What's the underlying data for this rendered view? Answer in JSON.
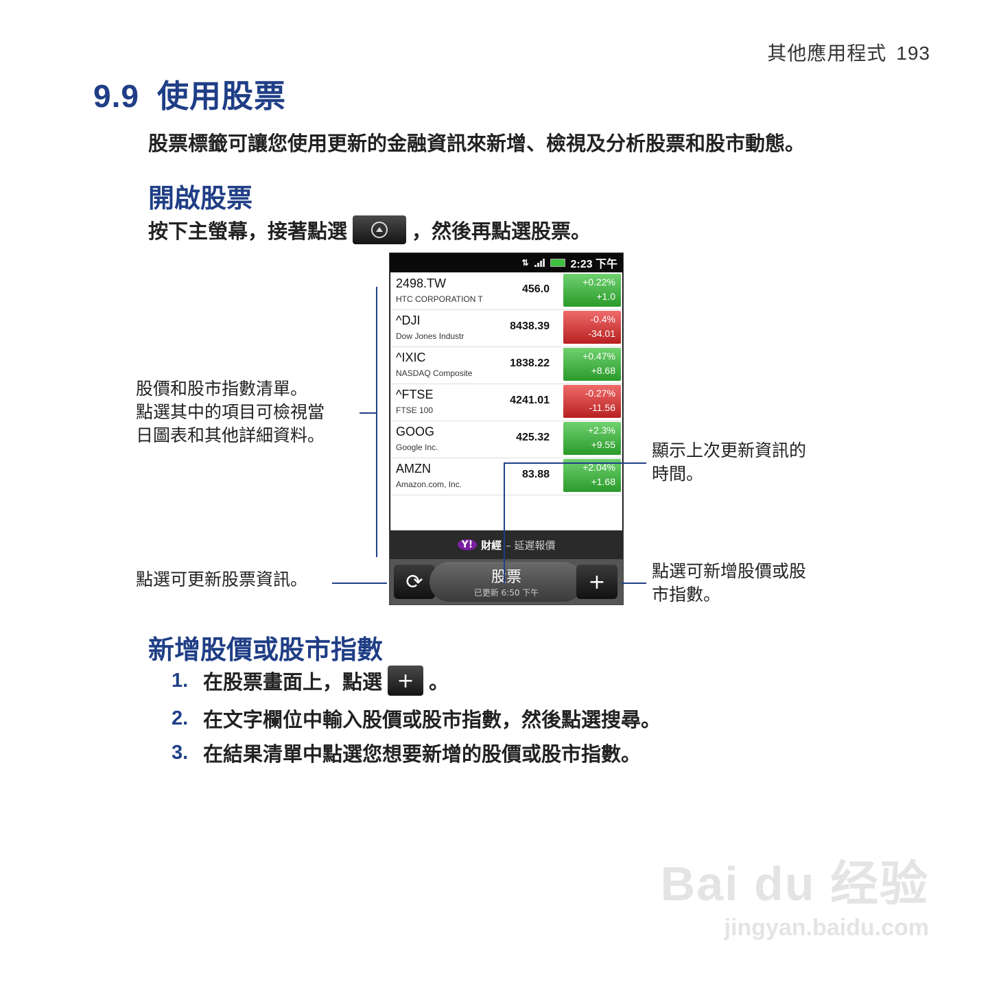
{
  "header": {
    "section": "其他應用程式",
    "page": "193"
  },
  "section": {
    "number": "9.9",
    "title": "使用股票"
  },
  "intro": "股票標籤可讓您使用更新的金融資訊來新增、檢視及分析股票和股市動態。",
  "open": {
    "heading": "開啟股票",
    "text_before": "按下主螢幕，接著點選",
    "text_after": "，然後再點選股票。"
  },
  "phone": {
    "status_time": "2:23 下午",
    "stocks": [
      {
        "symbol": "2498.TW",
        "name": "HTC CORPORATION T",
        "price": "456.0",
        "pct": "+0.22%",
        "chg": "+1.0",
        "dir": "up"
      },
      {
        "symbol": "^DJI",
        "name": "Dow Jones Industr",
        "price": "8438.39",
        "pct": "-0.4%",
        "chg": "-34.01",
        "dir": "down"
      },
      {
        "symbol": "^IXIC",
        "name": "NASDAQ Composite",
        "price": "1838.22",
        "pct": "+0.47%",
        "chg": "+8.68",
        "dir": "up"
      },
      {
        "symbol": "^FTSE",
        "name": "FTSE 100",
        "price": "4241.01",
        "pct": "-0.27%",
        "chg": "-11.56",
        "dir": "down"
      },
      {
        "symbol": "GOOG",
        "name": "Google Inc.",
        "price": "425.32",
        "pct": "+2.3%",
        "chg": "+9.55",
        "dir": "up"
      },
      {
        "symbol": "AMZN",
        "name": "Amazon.com, Inc.",
        "price": "83.88",
        "pct": "+2.04%",
        "chg": "+1.68",
        "dir": "up"
      }
    ],
    "footer_logo": "Y!",
    "footer_brand": "財經",
    "footer_text": "– 延遲報價",
    "bottom_title": "股票",
    "bottom_sub": "已更新 6:50 下午"
  },
  "callouts": {
    "list": [
      "股價和股市指數清單。",
      "點選其中的項目可檢視當",
      "日圖表和其他詳細資料。"
    ],
    "refresh": "點選可更新股票資訊。",
    "time": [
      "顯示上次更新資訊的",
      "時間。"
    ],
    "add": [
      "點選可新增股價或股",
      "市指數。"
    ]
  },
  "add_section": {
    "heading": "新增股價或股市指數",
    "steps": [
      {
        "n": "1.",
        "before": "在股票畫面上，點選",
        "after": "。"
      },
      {
        "n": "2.",
        "text": "在文字欄位中輸入股價或股市指數，然後點選搜尋。"
      },
      {
        "n": "3.",
        "text": "在結果清單中點選您想要新增的股價或股市指數。"
      }
    ]
  },
  "watermark": {
    "brand": "Bai du 经验",
    "url": "jingyan.baidu.com"
  }
}
